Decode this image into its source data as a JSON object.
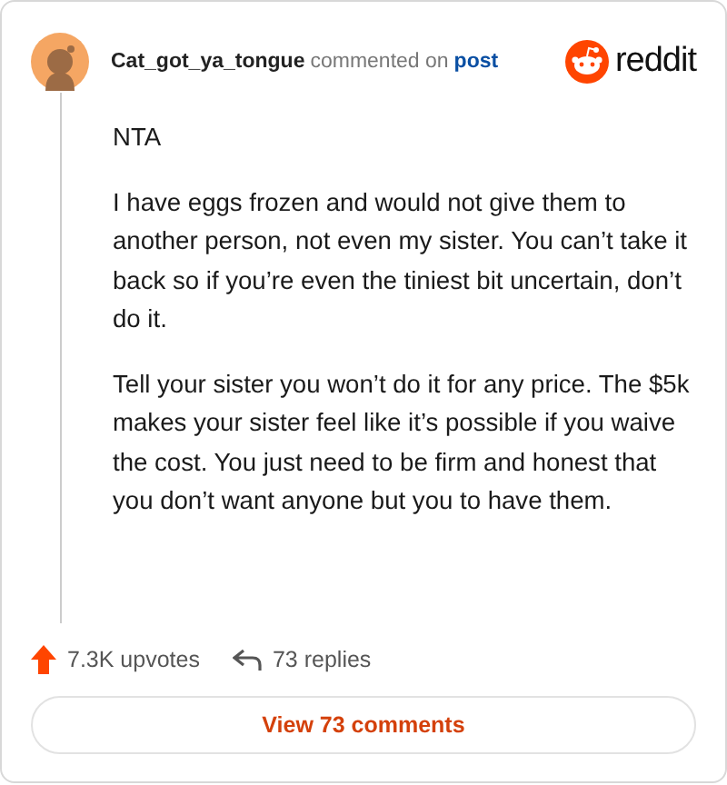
{
  "comment": {
    "author": "Cat_got_ya_tongue",
    "action": "commented on",
    "target": "post",
    "brand": "reddit",
    "paragraphs": [
      "NTA",
      "I have eggs frozen and would not give them to another person, not even my sister. You can’t take it back so if you’re even the tiniest bit uncertain, don’t do it.",
      "Tell your sister you won’t do it for any price. The $5k makes your sister feel like it’s possible if you waive the cost. You just need to be firm and honest that you don’t want anyone but you to have them."
    ],
    "upvotes": "7.3K upvotes",
    "replies": "73 replies"
  },
  "button": "View 73 comments"
}
